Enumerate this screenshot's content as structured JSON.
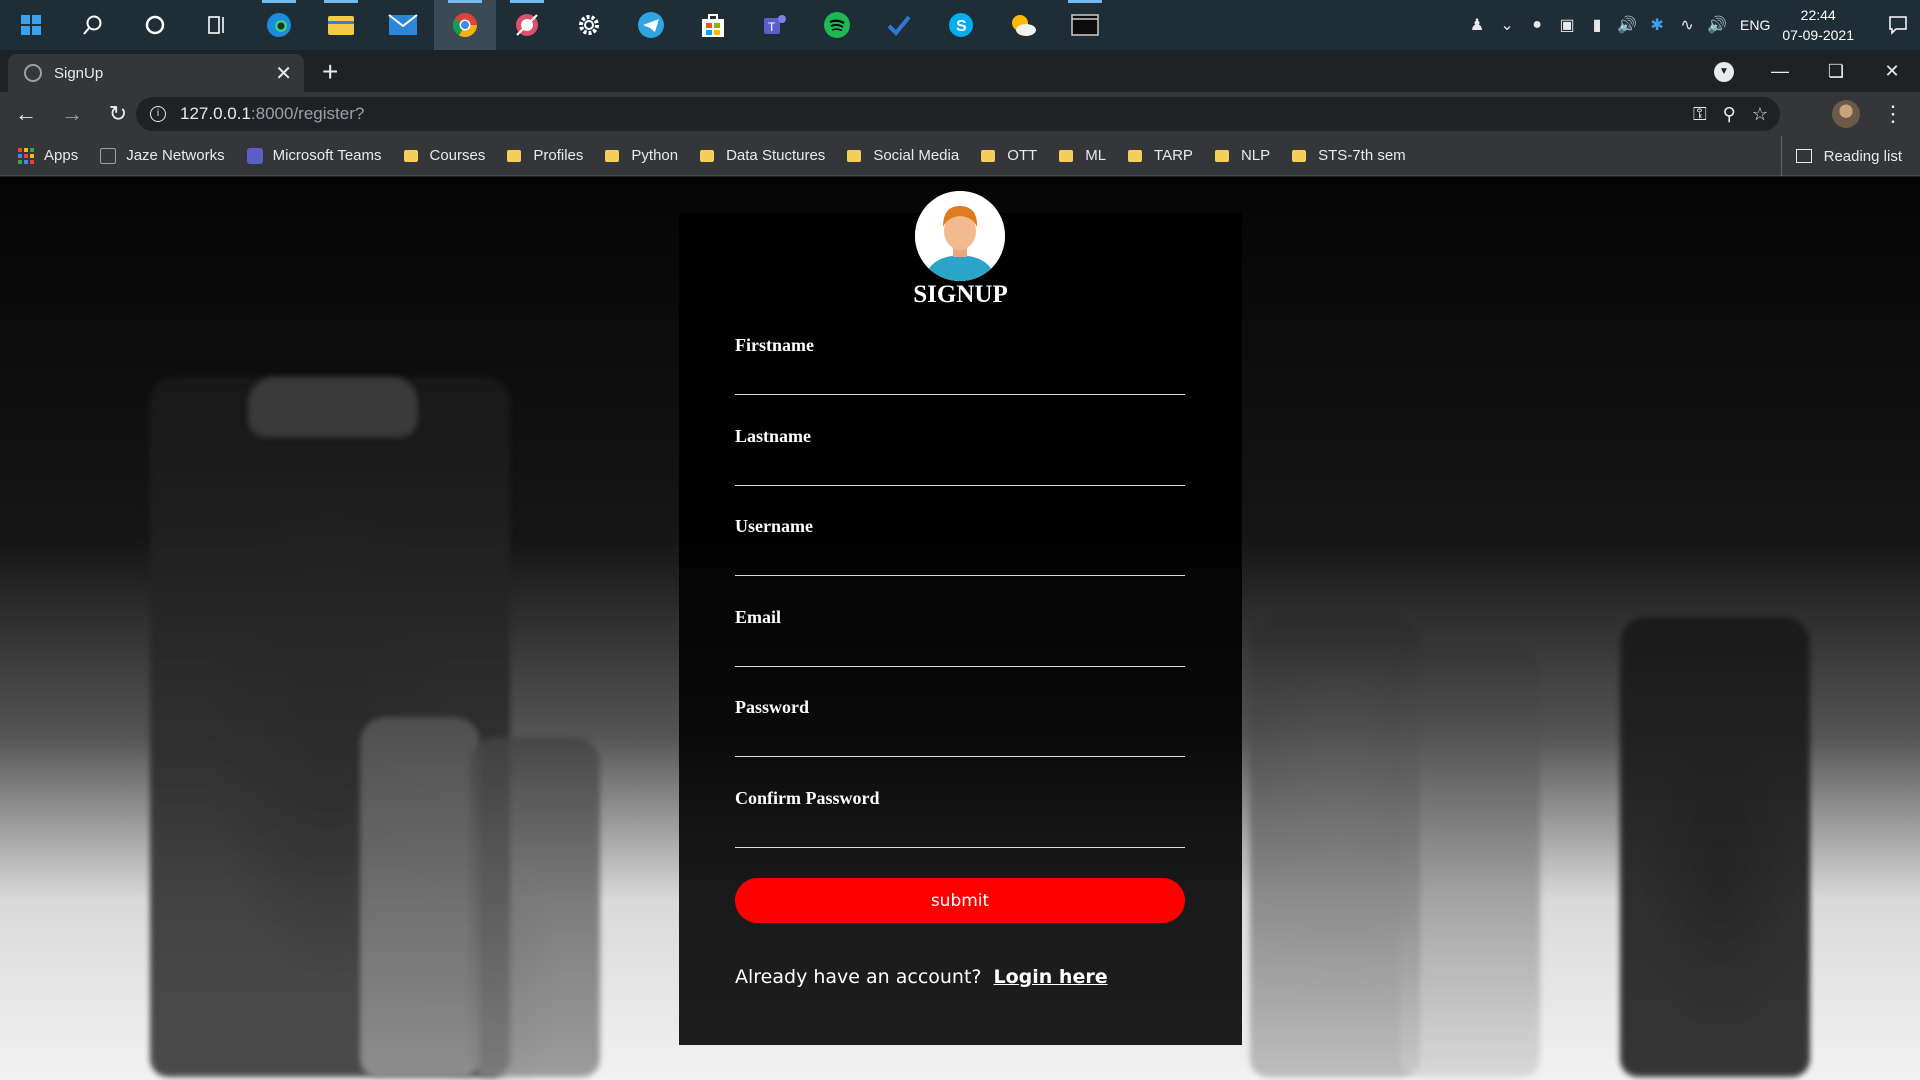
{
  "taskbar": {
    "apps": [
      "start-icon",
      "search-icon",
      "cortana-icon",
      "task-view-icon",
      "edge-icon",
      "file-explorer-icon",
      "mail-icon",
      "chrome-icon",
      "snip-icon",
      "settings-icon",
      "telegram-icon",
      "store-icon",
      "teams-icon",
      "spotify-icon",
      "todo-icon",
      "skype-icon",
      "weather-icon",
      "terminal-icon"
    ],
    "tray": {
      "language": "ENG",
      "time": "22:44",
      "date": "07-09-2021"
    }
  },
  "browser": {
    "tab_title": "SignUp",
    "url_host": "127.0.0.1",
    "url_path": ":8000/register?",
    "bookmarks": [
      "Apps",
      "Jaze Networks",
      "Microsoft Teams",
      "Courses",
      "Profiles",
      "Python",
      "Data Stuctures",
      "Social Media",
      "OTT",
      "ML",
      "TARP",
      "NLP",
      "STS-7th sem"
    ],
    "reading_list": "Reading list"
  },
  "form": {
    "title": "SIGNUP",
    "fields": [
      {
        "label": "Firstname",
        "value": ""
      },
      {
        "label": "Lastname",
        "value": ""
      },
      {
        "label": "Username",
        "value": ""
      },
      {
        "label": "Email",
        "value": ""
      },
      {
        "label": "Password",
        "value": ""
      },
      {
        "label": "Confirm Password",
        "value": ""
      }
    ],
    "submit_label": "submit",
    "login_prompt": "Already have an account?",
    "login_link": "Login here"
  },
  "colors": {
    "submit_bg": "#ff0000",
    "card_bg": "#000000",
    "taskbar_bg": "#1f2d37"
  }
}
